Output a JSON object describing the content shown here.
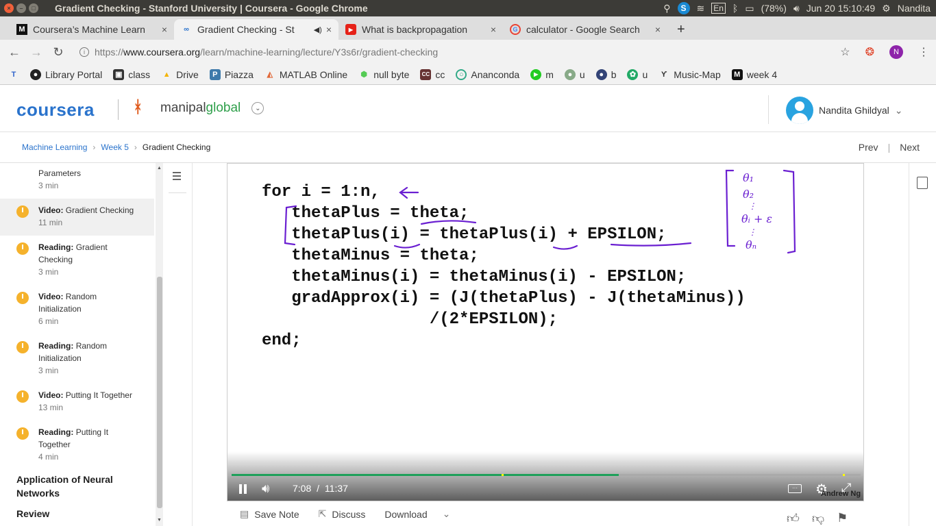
{
  "system": {
    "window_title": "Gradient Checking - Stanford University | Coursera - Google Chrome",
    "keyboard": "En",
    "battery": "(78%)",
    "datetime": "Jun 20 15:10:49",
    "user": "Nandita"
  },
  "tabs": [
    {
      "label": "Coursera’s Machine Learn",
      "icon": "medium-icon"
    },
    {
      "label": "Gradient Checking - St",
      "icon": "coursera-link-icon"
    },
    {
      "label": "What is backpropagation",
      "icon": "youtube-icon"
    },
    {
      "label": "calculator - Google Search",
      "icon": "google-icon"
    }
  ],
  "omnibar": {
    "url_scheme": "https://",
    "url_domain": "www.coursera.org",
    "url_path": "/learn/machine-learning/lecture/Y3s6r/gradient-checking",
    "profile_initial": "N"
  },
  "bookmarks": [
    {
      "label": "",
      "icon": "t2-icon"
    },
    {
      "label": "Library Portal",
      "icon": "github-icon"
    },
    {
      "label": "class",
      "icon": "classroom-icon"
    },
    {
      "label": "Drive",
      "icon": "drive-icon"
    },
    {
      "label": "Piazza",
      "icon": "piazza-icon"
    },
    {
      "label": "MATLAB Online",
      "icon": "matlab-icon"
    },
    {
      "label": "null byte",
      "icon": "nullbyte-icon"
    },
    {
      "label": "cc",
      "icon": "cc-icon"
    },
    {
      "label": "Ananconda",
      "icon": "anaconda-icon"
    },
    {
      "label": "m",
      "icon": "play-icon"
    },
    {
      "label": "u",
      "icon": "ext-u1-icon"
    },
    {
      "label": "b",
      "icon": "ext-b-icon"
    },
    {
      "label": "u",
      "icon": "ext-u2-icon"
    },
    {
      "label": "Music-Map",
      "icon": "musicmap-icon"
    },
    {
      "label": "week 4",
      "icon": "medium-icon"
    }
  ],
  "header": {
    "logo": "coursera",
    "partner_prefix": "manipal",
    "partner_suffix": "global",
    "user_name": "Nandita Ghildyal"
  },
  "breadcrumb": {
    "course": "Machine Learning",
    "week": "Week 5",
    "current": "Gradient Checking",
    "prev": "Prev",
    "next": "Next"
  },
  "sidebar": {
    "items": [
      {
        "kind": "",
        "title": "Parameters",
        "duration": "3 min"
      },
      {
        "kind": "Video:",
        "title": "Gradient Checking",
        "duration": "11 min"
      },
      {
        "kind": "Reading:",
        "title": "Gradient Checking",
        "duration": "3 min"
      },
      {
        "kind": "Video:",
        "title": "Random Initialization",
        "duration": "6 min"
      },
      {
        "kind": "Reading:",
        "title": "Random Initialization",
        "duration": "3 min"
      },
      {
        "kind": "Video:",
        "title": "Putting It Together",
        "duration": "13 min"
      },
      {
        "kind": "Reading:",
        "title": "Putting It Together",
        "duration": "4 min"
      }
    ],
    "sections": [
      "Application of Neural Networks",
      "Review"
    ]
  },
  "video": {
    "code_lines": [
      "for i = 1:n,",
      "   thetaPlus = theta;",
      "   thetaPlus(i) = thetaPlus(i) + EPSILON;",
      "   thetaMinus = theta;",
      "   thetaMinus(i) = thetaMinus(i) - EPSILON;",
      "   gradApprox(i) = (J(thetaPlus) - J(thetaMinus))",
      "                 /(2*EPSILON);",
      "end;"
    ],
    "matrix_entries": [
      "θ₁",
      "θ₂",
      "θᵢ + ε",
      "θₙ"
    ],
    "current_time": "7:08",
    "separator": "/",
    "total_time": "11:37",
    "progress": 0.615,
    "watermark": "Andrew Ng"
  },
  "below_video": {
    "save_note": "Save Note",
    "discuss": "Discuss",
    "download": "Download"
  },
  "colors": {
    "coursera_blue": "#2a73cc",
    "progress_green": "#1ea05a",
    "clock_yellow": "#f5b22c",
    "annotation_purple": "#6a1fd1"
  }
}
